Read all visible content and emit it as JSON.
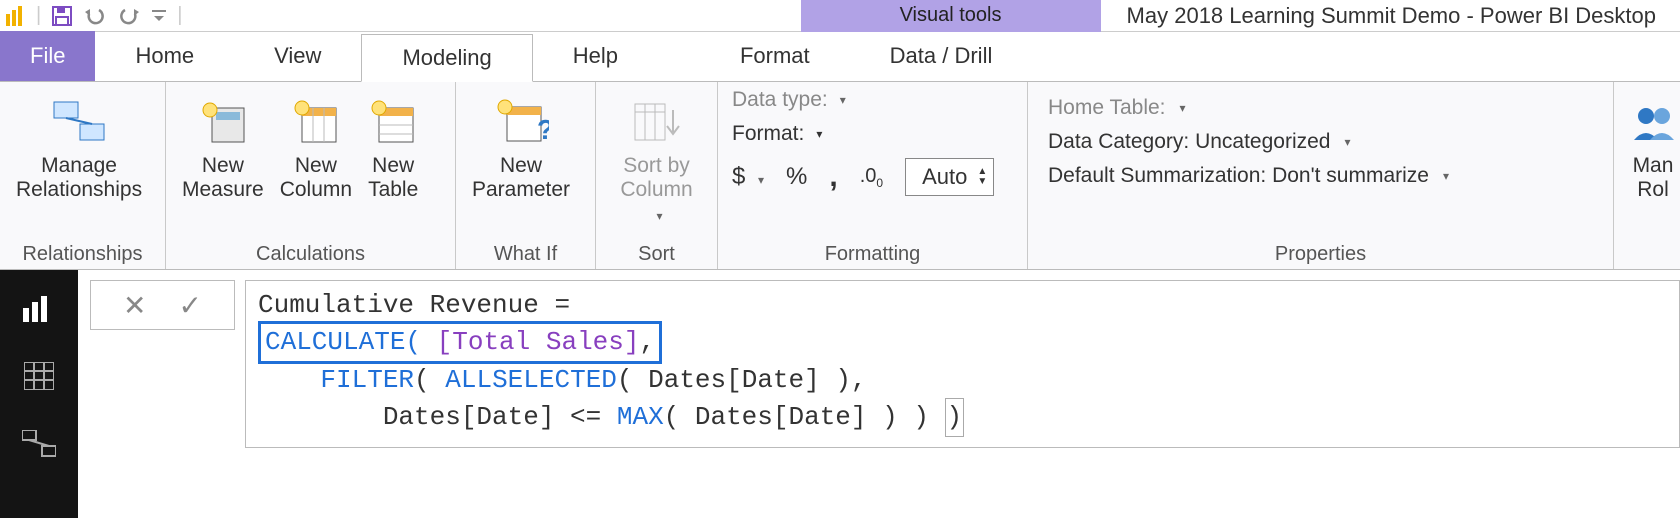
{
  "titlebar": {
    "context_tab": "Visual tools",
    "app_title": "May 2018 Learning Summit Demo - Power BI Desktop"
  },
  "tabs": {
    "file": "File",
    "home": "Home",
    "view": "View",
    "modeling": "Modeling",
    "help": "Help",
    "format": "Format",
    "data_drill": "Data / Drill"
  },
  "ribbon": {
    "relationships": {
      "group_label": "Relationships",
      "manage": "Manage\nRelationships"
    },
    "calculations": {
      "group_label": "Calculations",
      "new_measure": "New\nMeasure",
      "new_column": "New\nColumn",
      "new_table": "New\nTable"
    },
    "whatif": {
      "group_label": "What If",
      "new_parameter": "New\nParameter"
    },
    "sort": {
      "group_label": "Sort",
      "sort_by_column": "Sort by\nColumn"
    },
    "formatting": {
      "group_label": "Formatting",
      "data_type_label": "Data type:",
      "format_label": "Format:",
      "auto_value": "Auto"
    },
    "properties": {
      "group_label": "Properties",
      "home_table_label": "Home Table:",
      "data_category_label": "Data Category: Uncategorized",
      "default_summarization_label": "Default Summarization: Don't summarize"
    },
    "security": {
      "manage_roles": "Man\nRol"
    }
  },
  "icons": {
    "save": "save",
    "undo": "undo",
    "redo": "redo",
    "qat_dropdown": "qat-dropdown"
  },
  "formula": {
    "measure_name": "Cumulative Revenue =",
    "line2_pre": "CALCULATE( ",
    "line2_col": "[Total Sales]",
    "line2_post": ",",
    "line3": "    FILTER( ALLSELECTED( Dates[Date] ),",
    "line4_a": "        Dates[Date] <= ",
    "line4_b": "MAX",
    "line4_c": "( Dates[Date] ) ) ",
    "line4_d": ")"
  }
}
